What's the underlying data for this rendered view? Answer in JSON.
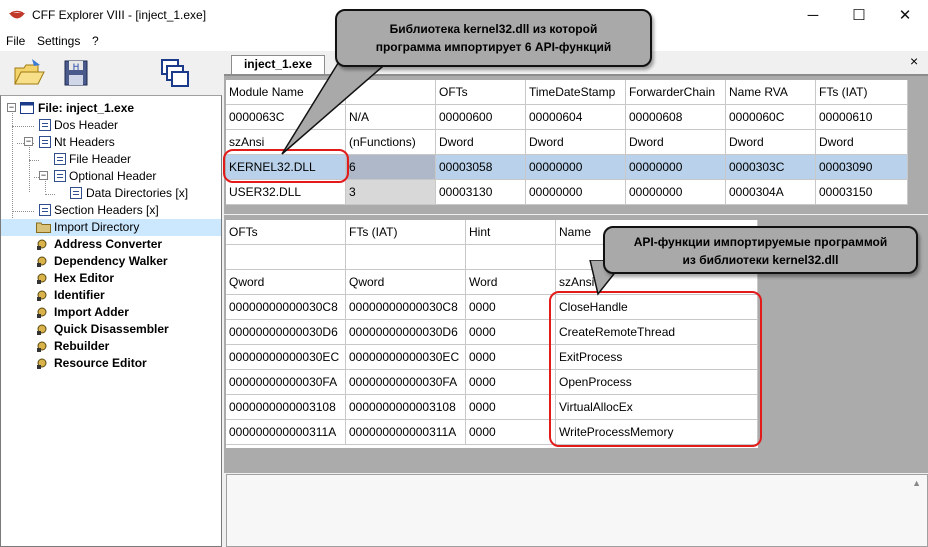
{
  "window": {
    "title": "CFF Explorer VIII - [inject_1.exe]",
    "minimize": "─",
    "maximize": "☐",
    "close": "✕"
  },
  "menu": [
    "File",
    "Settings",
    "?"
  ],
  "tab": {
    "label": "inject_1.exe",
    "close": "×"
  },
  "tree": [
    {
      "label": "File: inject_1.exe",
      "bold": true,
      "icon": "window-icon"
    },
    {
      "label": "Dos Header",
      "icon": "page-icon"
    },
    {
      "label": "Nt Headers",
      "icon": "page-icon"
    },
    {
      "label": "File Header",
      "icon": "page-icon"
    },
    {
      "label": "Optional Header",
      "icon": "page-icon"
    },
    {
      "label": "Data Directories [x]",
      "icon": "page-icon"
    },
    {
      "label": "Section Headers [x]",
      "icon": "page-icon"
    },
    {
      "label": "Import Directory",
      "icon": "folder-icon",
      "selected": true
    },
    {
      "label": "Address Converter",
      "bold": true,
      "icon": "tool-icon"
    },
    {
      "label": "Dependency Walker",
      "bold": true,
      "icon": "tool-icon"
    },
    {
      "label": "Hex Editor",
      "bold": true,
      "icon": "tool-icon"
    },
    {
      "label": "Identifier",
      "bold": true,
      "icon": "tool-icon"
    },
    {
      "label": "Import Adder",
      "bold": true,
      "icon": "tool-icon"
    },
    {
      "label": "Quick Disassembler",
      "bold": true,
      "icon": "tool-icon"
    },
    {
      "label": "Rebuilder",
      "bold": true,
      "icon": "tool-icon"
    },
    {
      "label": "Resource Editor",
      "bold": true,
      "icon": "tool-icon"
    }
  ],
  "modules": {
    "headers": [
      "Module Name",
      "",
      "OFTs",
      "TimeDateStamp",
      "ForwarderChain",
      "Name RVA",
      "FTs (IAT)"
    ],
    "rows": [
      [
        "0000063C",
        "N/A",
        "00000600",
        "00000604",
        "00000608",
        "0000060C",
        "00000610"
      ],
      [
        "szAnsi",
        "(nFunctions)",
        "Dword",
        "Dword",
        "Dword",
        "Dword",
        "Dword"
      ],
      [
        "KERNEL32.DLL",
        "6",
        "00003058",
        "00000000",
        "00000000",
        "0000303C",
        "00003090"
      ],
      [
        "USER32.DLL",
        "3",
        "00003130",
        "00000000",
        "00000000",
        "0000304A",
        "00003150"
      ]
    ]
  },
  "functions": {
    "headers": [
      "OFTs",
      "FTs (IAT)",
      "Hint",
      "Name"
    ],
    "types": [
      "Qword",
      "Qword",
      "Word",
      "szAnsi"
    ],
    "rows": [
      [
        "00000000000030C8",
        "00000000000030C8",
        "0000",
        "CloseHandle"
      ],
      [
        "00000000000030D6",
        "00000000000030D6",
        "0000",
        "CreateRemoteThread"
      ],
      [
        "00000000000030EC",
        "00000000000030EC",
        "0000",
        "ExitProcess"
      ],
      [
        "00000000000030FA",
        "00000000000030FA",
        "0000",
        "OpenProcess"
      ],
      [
        "0000000000003108",
        "0000000000003108",
        "0000",
        "VirtualAllocEx"
      ],
      [
        "000000000000311A",
        "000000000000311A",
        "0000",
        "WriteProcessMemory"
      ]
    ]
  },
  "annotations": {
    "top_line1": "Библиотека kernel32.dll из которой",
    "top_line2": "программа импортирует 6 API-функций",
    "right_line1": "API-функции импортируемые программой",
    "right_line2": "из библиотеки kernel32.dll"
  },
  "colors": {
    "selection": "#cce8ff",
    "row_highlight": "#b9d1ea",
    "annotation_border": "#e21a1a"
  }
}
